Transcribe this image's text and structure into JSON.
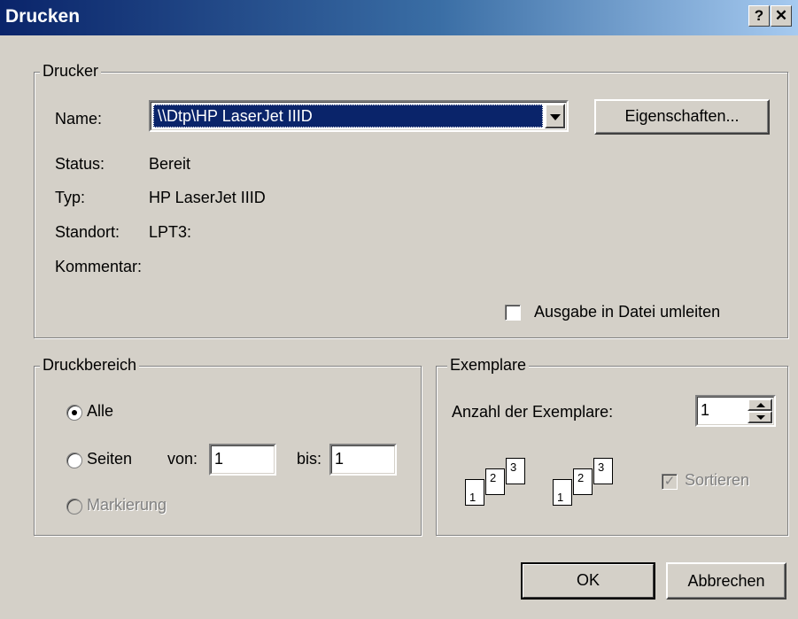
{
  "dialog": {
    "title": "Drucken",
    "help_glyph": "?",
    "close_glyph": "✕"
  },
  "printer": {
    "group_label": "Drucker",
    "name_label": "Name:",
    "name_value": "\\\\Dtp\\HP LaserJet IIID",
    "properties_button": "Eigenschaften...",
    "status_label": "Status:",
    "status_value": "Bereit",
    "type_label": "Typ:",
    "type_value": "HP LaserJet IIID",
    "location_label": "Standort:",
    "location_value": "LPT3:",
    "comment_label": "Kommentar:",
    "comment_value": "",
    "print_to_file_label": "Ausgabe in Datei umleiten",
    "print_to_file_checked": false
  },
  "range": {
    "group_label": "Druckbereich",
    "all_label": "Alle",
    "all_selected": true,
    "pages_label": "Seiten",
    "from_label": "von:",
    "from_value": "1",
    "to_label": "bis:",
    "to_value": "1",
    "selection_label": "Markierung"
  },
  "copies": {
    "group_label": "Exemplare",
    "count_label": "Anzahl der Exemplare:",
    "count_value": "1",
    "collate_label": "Sortieren",
    "collate_checked": true,
    "page_numbers": [
      "1",
      "2",
      "3"
    ]
  },
  "buttons": {
    "ok": "OK",
    "cancel": "Abbrechen"
  },
  "colors": {
    "title_start": "#0a246a",
    "title_end": "#a6caf0",
    "selection": "#0a246a",
    "face": "#d4d0c8"
  }
}
